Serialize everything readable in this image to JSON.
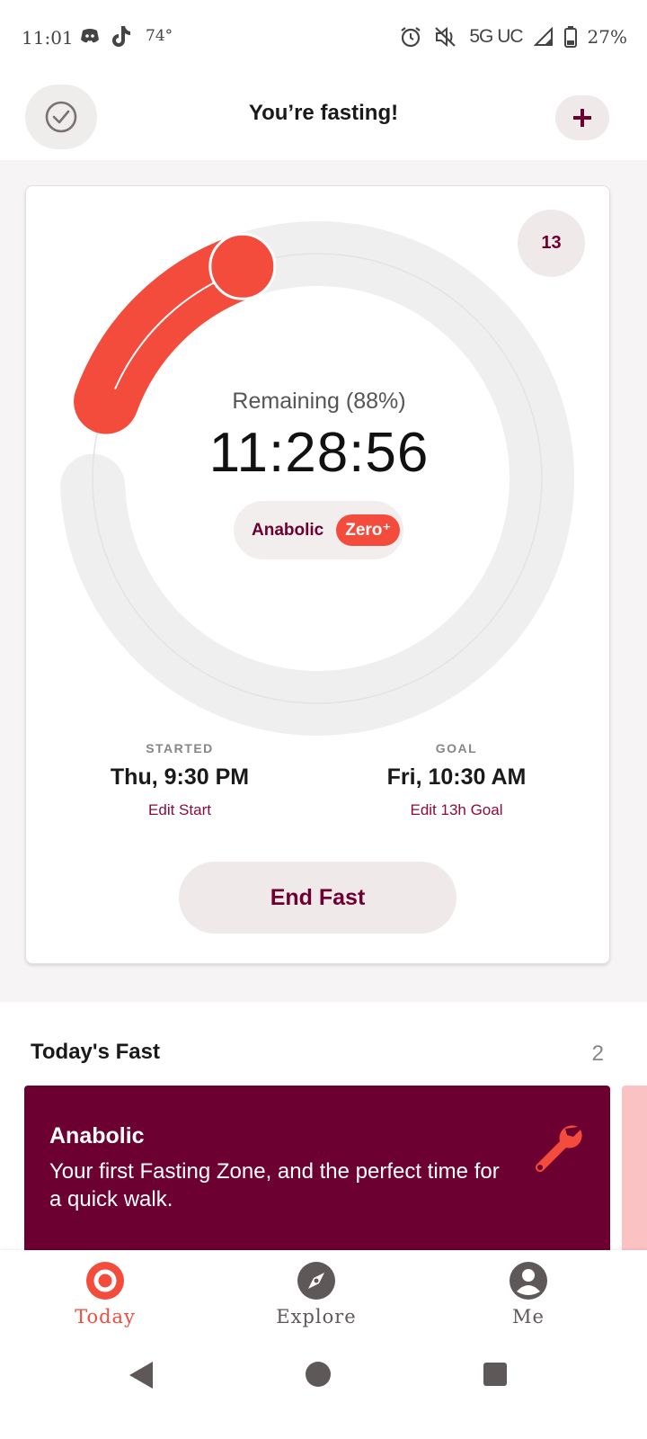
{
  "status_bar": {
    "time": "11:01",
    "temperature": "74°",
    "network": "5G UC",
    "battery": "27%",
    "icons": [
      "discord-icon",
      "tiktok-icon",
      "alarm-icon",
      "mute-icon",
      "signal-icon",
      "battery-icon"
    ]
  },
  "header": {
    "title": "You’re fasting!",
    "left_icon": "check-circle-icon",
    "right_icon": "plus-icon"
  },
  "timer": {
    "progress_fraction": 0.12,
    "zone_badge": "13",
    "remaining_label": "Remaining (88%)",
    "time_remaining": "11:28:56",
    "zone_name": "Anabolic",
    "zone_badge_label": "Zero⁺"
  },
  "started": {
    "label": "STARTED",
    "value": "Thu, 9:30 PM",
    "edit": "Edit Start"
  },
  "goal": {
    "label": "GOAL",
    "value": "Fri, 10:30 AM",
    "edit": "Edit 13h Goal"
  },
  "end_button": "End Fast",
  "todays_fast": {
    "title": "Today's Fast",
    "count": "2",
    "zone_card": {
      "title": "Anabolic",
      "text": "Your first Fasting Zone, and the perfect time for a quick walk.",
      "icon": "wrench-icon"
    }
  },
  "bottom_nav": [
    {
      "label": "Today",
      "icon": "today-icon",
      "active": true
    },
    {
      "label": "Explore",
      "icon": "compass-icon",
      "active": false
    },
    {
      "label": "Me",
      "icon": "profile-icon",
      "active": false
    }
  ],
  "colors": {
    "accent": "#f44c3c",
    "brand_dark": "#6c0030",
    "track": "#efefef"
  }
}
